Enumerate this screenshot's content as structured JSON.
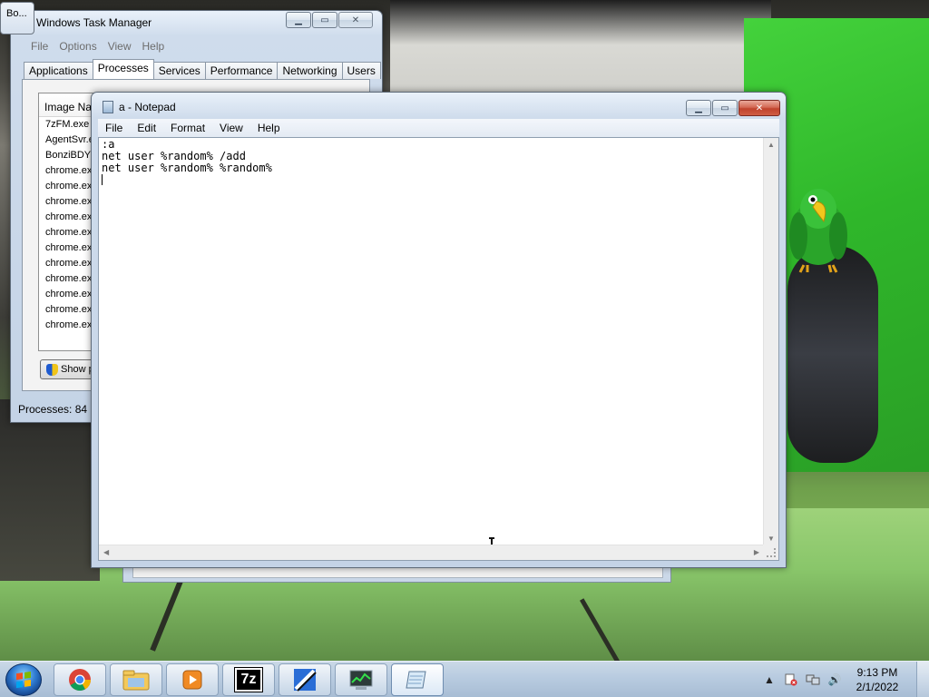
{
  "stray_window": {
    "label": "Bo..."
  },
  "task_manager": {
    "title": "Windows Task Manager",
    "menu": [
      "File",
      "Options",
      "View",
      "Help"
    ],
    "tabs": [
      "Applications",
      "Processes",
      "Services",
      "Performance",
      "Networking",
      "Users"
    ],
    "active_tab": "Processes",
    "column_header": "Image Nam",
    "processes": [
      "7zFM.exe",
      "AgentSvr.e",
      "BonziBDY_",
      "chrome.ex",
      "chrome.ex",
      "chrome.ex",
      "chrome.ex",
      "chrome.ex",
      "chrome.ex",
      "chrome.ex",
      "chrome.ex",
      "chrome.ex",
      "chrome.ex",
      "chrome.ex"
    ],
    "show_button": "Show p",
    "status": "Processes: 84"
  },
  "notepad": {
    "title": "a - Notepad",
    "menu": [
      "File",
      "Edit",
      "Format",
      "View",
      "Help"
    ],
    "content": ":a\nnet user %random% /add\nnet user %random% %random%\n"
  },
  "taskbar": {
    "pinned": [
      "chrome-icon",
      "explorer-icon",
      "media-player-icon",
      "7zip-icon",
      "bonzi-icon",
      "task-manager-icon",
      "notepad-icon"
    ],
    "sevenzip_label": "7z",
    "clock_time": "9:13 PM",
    "clock_date": "2/1/2022"
  },
  "colors": {
    "accent_green": "#35b830",
    "title_close": "#c0432d",
    "taskbar": "#b8cbe0"
  }
}
